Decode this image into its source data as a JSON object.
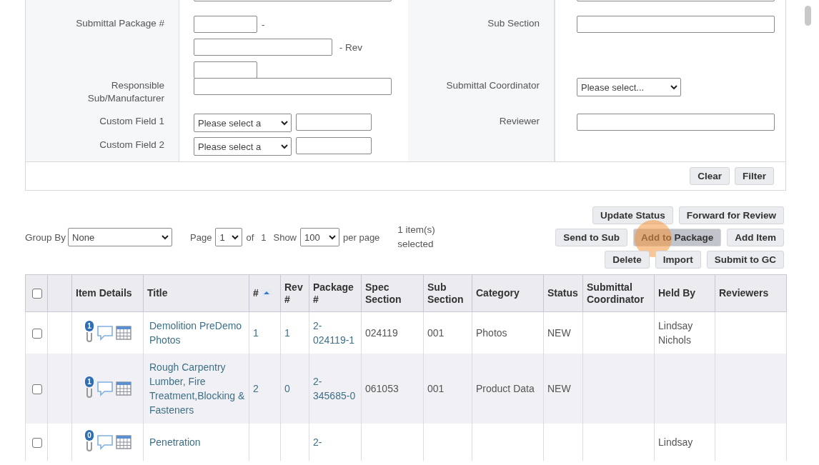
{
  "filters": {
    "left": [
      {
        "kind": "text"
      },
      {
        "kind": "package",
        "label": "Submittal Package #",
        "separator": "-",
        "rev_label": "- Rev"
      },
      {
        "kind": "text",
        "label": "Responsible Sub/Manufacturer"
      },
      {
        "kind": "select-text",
        "label": "Custom Field 1",
        "value": "Please select a"
      },
      {
        "kind": "select-text",
        "label": "Custom Field 2",
        "value": "Please select a"
      }
    ],
    "right": [
      {
        "kind": "text"
      },
      {
        "kind": "text",
        "label": "Sub Section"
      },
      {
        "kind": "select",
        "label": "Submittal Coordinator",
        "value": "Please select..."
      },
      {
        "kind": "text",
        "label": "Reviewer"
      }
    ],
    "buttons": [
      "Clear",
      "Filter"
    ]
  },
  "toolbar": {
    "group_by": {
      "label": "Group By",
      "value": "None"
    },
    "page": {
      "label": "Page",
      "value": "1",
      "of_label": "of",
      "total": "1"
    },
    "show": {
      "label": "Show",
      "value": "100",
      "suffix": "per page"
    },
    "selection": "1 item(s) selected",
    "actions": [
      [
        {
          "label": "Update Status",
          "selected": false,
          "cursor": false
        },
        {
          "label": "Forward for Review",
          "selected": false,
          "cursor": false
        }
      ],
      [
        {
          "label": "Send to Sub",
          "selected": false,
          "cursor": false
        },
        {
          "label": "Add to Package",
          "selected": true,
          "cursor": true
        },
        {
          "label": "Add Item",
          "selected": false,
          "cursor": false
        }
      ],
      [
        {
          "label": "Delete",
          "selected": false,
          "cursor": false
        },
        {
          "label": "Import",
          "selected": false,
          "cursor": false
        },
        {
          "label": "Submit to GC",
          "selected": false,
          "cursor": false
        }
      ]
    ]
  },
  "table": {
    "columns": [
      {
        "kind": "checkbox",
        "checked": false
      },
      {
        "kind": "blank"
      },
      {
        "kind": "text",
        "label": "Item Details"
      },
      {
        "kind": "text",
        "label": "Title"
      },
      {
        "kind": "text",
        "label": "#",
        "sorted_ascending": true
      },
      {
        "kind": "text",
        "label": "Rev #"
      },
      {
        "kind": "text",
        "label": "Package #"
      },
      {
        "kind": "text",
        "label": "Spec Section"
      },
      {
        "kind": "text",
        "label": "Sub Section"
      },
      {
        "kind": "text",
        "label": "Category"
      },
      {
        "kind": "text",
        "label": "Status"
      },
      {
        "kind": "text",
        "label": "Submittal Coordinator"
      },
      {
        "kind": "text",
        "label": "Held By"
      },
      {
        "kind": "text",
        "label": "Reviewers"
      }
    ],
    "rows": [
      {
        "checked": false,
        "attachments": "1",
        "title": "Demolition PreDemo Photos",
        "number": "1",
        "rev": "1",
        "package": "2-024119-1",
        "spec_section": "024119",
        "sub_section": "001",
        "category": "Photos",
        "status": "NEW",
        "held_by": "Lindsay Nichols"
      },
      {
        "checked": false,
        "attachments": "1",
        "title": "Rough Carpentry Lumber, Fire Treatment,Blocking & Fasteners",
        "number": "2",
        "rev": "0",
        "package": "2-345685-0",
        "spec_section": "061053",
        "sub_section": "001",
        "category": "Product Data",
        "status": "NEW"
      },
      {
        "checked": false,
        "attachments": "0",
        "title": "Penetration",
        "package": "2-",
        "held_by": "Lindsay"
      }
    ]
  }
}
